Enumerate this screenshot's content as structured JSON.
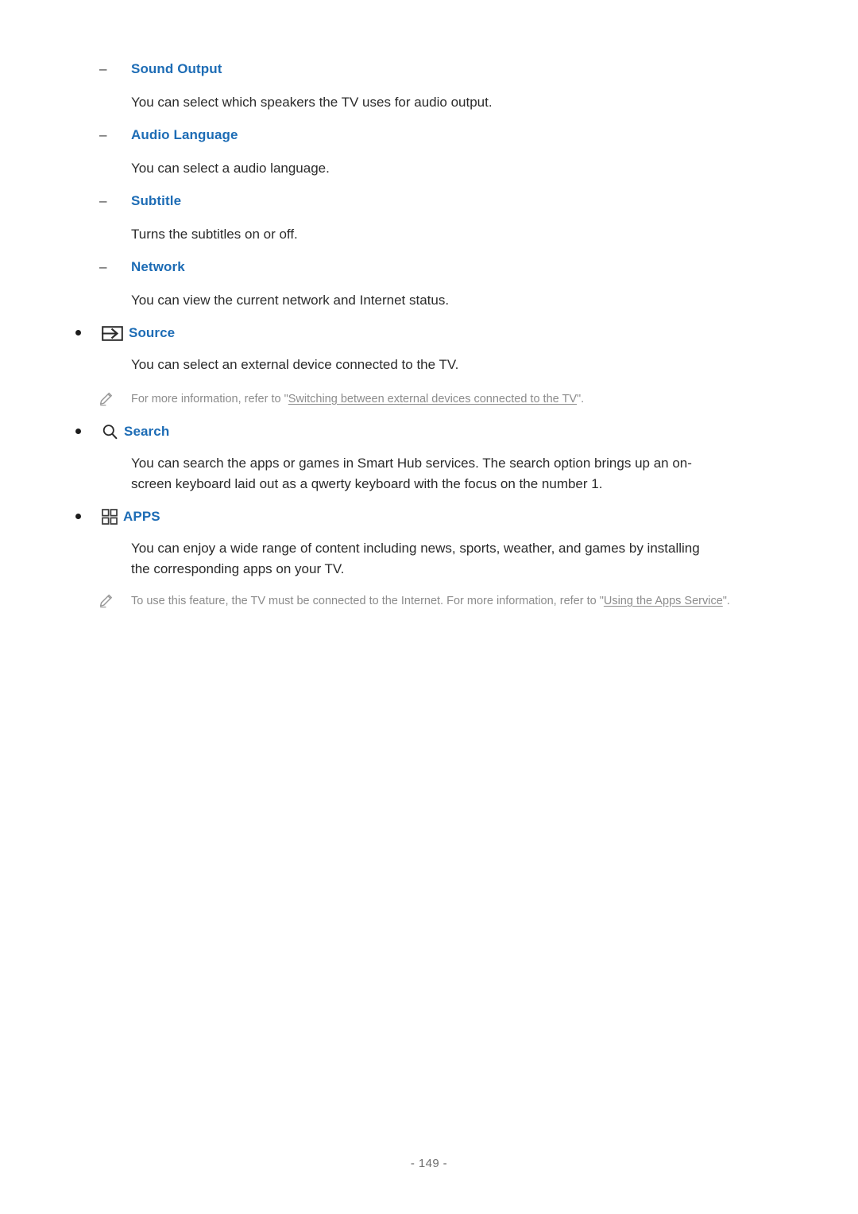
{
  "page": {
    "number_label": "- 149 -",
    "accent_color": "#1d6cb5",
    "body_color": "#2b2b2b",
    "note_color": "#8c8c8c",
    "background": "#ffffff"
  },
  "sections": {
    "sound_output": {
      "marker": "–",
      "heading": "Sound Output",
      "body": "You can select which speakers the TV uses for audio output."
    },
    "audio_language": {
      "marker": "–",
      "heading": "Audio Language",
      "body": "You can select a audio language."
    },
    "subtitle": {
      "marker": "–",
      "heading": "Subtitle",
      "body": "Turns the subtitles on or off."
    },
    "network": {
      "marker": "–",
      "heading": "Network",
      "body": "You can view the current network and Internet status."
    },
    "source": {
      "icon": "source-arrow-box-icon",
      "heading": "Source",
      "body": "You can select an external device connected to the TV.",
      "note": {
        "icon": "pencil-icon",
        "prefix": "For more information, refer to \"",
        "link": "Switching between external devices connected to the TV",
        "suffix": "\"."
      }
    },
    "search": {
      "icon": "search-magnifier-icon",
      "heading": "Search",
      "body": "You can search the apps or games in Smart Hub services. The search option brings up an on-screen keyboard laid out as a qwerty keyboard with the focus on the number 1."
    },
    "apps": {
      "icon": "apps-grid-icon",
      "heading": "APPS",
      "body": "You can enjoy a wide range of content including news, sports, weather, and games by installing the corresponding apps on your TV.",
      "note": {
        "icon": "pencil-icon",
        "prefix": "To use this feature, the TV must be connected to the Internet. For more information, refer to \"",
        "link": "Using the Apps Service",
        "suffix": "\"."
      }
    }
  }
}
